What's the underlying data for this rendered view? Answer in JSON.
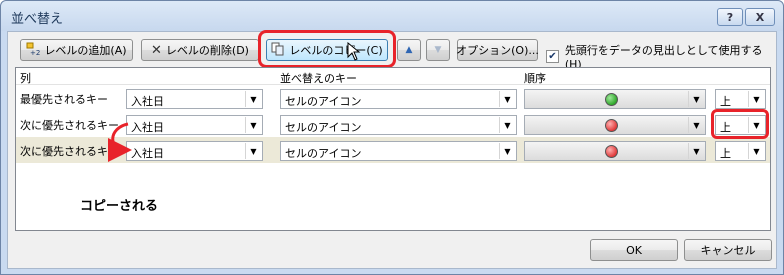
{
  "window": {
    "title": "並べ替え",
    "help_label": "?",
    "close_label": "X"
  },
  "toolbar": {
    "add_label": "レベルの追加(A)",
    "delete_label": "レベルの削除(D)",
    "copy_label": "レベルのコピー(C)",
    "up_label": "▲",
    "down_label": "▼",
    "options_label": "オプション(O)...",
    "header_checkbox_label": "先頭行をデータの見出しとして使用する(H)",
    "header_checkbox_checked": true
  },
  "grid": {
    "headers": {
      "column": "列",
      "sort_on": "並べ替えのキー",
      "order": "順序"
    },
    "rows": [
      {
        "label": "最優先されるキー",
        "column": "入社日",
        "sort_on": "セルのアイコン",
        "icon_color": "green",
        "direction": "上"
      },
      {
        "label": "次に優先されるキー",
        "column": "入社日",
        "sort_on": "セルのアイコン",
        "icon_color": "red",
        "direction": "上"
      },
      {
        "label": "次に優先されるキー",
        "column": "入社日",
        "sort_on": "セルのアイコン",
        "icon_color": "red",
        "direction": "上"
      }
    ]
  },
  "annotation": {
    "text": "コピーされる",
    "highlight_color": "#e8232a"
  },
  "footer": {
    "ok_label": "OK",
    "cancel_label": "キャンセル"
  }
}
